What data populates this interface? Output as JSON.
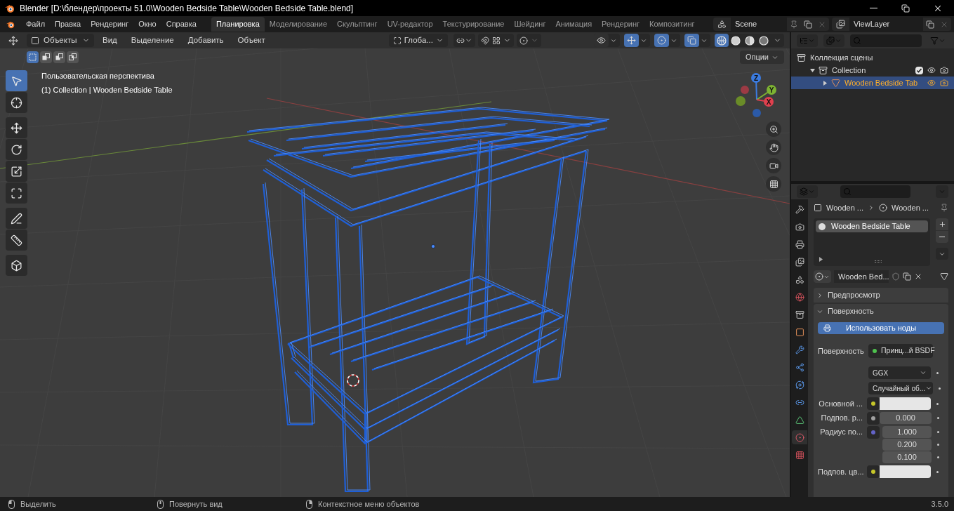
{
  "window": {
    "title": "Blender [D:\\блендер\\проекты 51.0\\Wooden Bedside Table\\Wooden Bedside Table.blend]"
  },
  "menus": [
    "Файл",
    "Правка",
    "Рендеринг",
    "Окно",
    "Справка"
  ],
  "workspaces": [
    {
      "label": "Планировка",
      "selected": true
    },
    {
      "label": "Моделирование",
      "selected": false
    },
    {
      "label": "Скульптинг",
      "selected": false
    },
    {
      "label": "UV-редактор",
      "selected": false
    },
    {
      "label": "Текстурирование",
      "selected": false
    },
    {
      "label": "Шейдинг",
      "selected": false
    },
    {
      "label": "Анимация",
      "selected": false
    },
    {
      "label": "Рендеринг",
      "selected": false
    },
    {
      "label": "Композитинг",
      "selected": false
    }
  ],
  "scene": "Scene",
  "view_layer": "ViewLayer",
  "viewport": {
    "mode": "Объекты",
    "menus": [
      "Вид",
      "Выделение",
      "Добавить",
      "Объект"
    ],
    "orientation": "Глоба...",
    "toggles": [
      {
        "kind": "visibility",
        "on": false
      },
      {
        "kind": "gizmo",
        "on": true
      },
      {
        "kind": "overlay",
        "on": true
      },
      {
        "kind": "xray",
        "on": true
      }
    ],
    "shading_modes": [
      {
        "kind": "wireframe",
        "selected": true
      },
      {
        "kind": "solid",
        "selected": false
      },
      {
        "kind": "material",
        "selected": false
      },
      {
        "kind": "rendered",
        "selected": false
      }
    ],
    "select_modes": [
      {
        "kind": "new",
        "selected": true
      },
      {
        "kind": "extend",
        "selected": false
      },
      {
        "kind": "subtract",
        "selected": false
      },
      {
        "kind": "intersect",
        "selected": false
      }
    ],
    "options_button": "Опции",
    "overlay_lines": [
      "Пользовательская перспектива",
      "(1) Collection | Wooden Bedside Table"
    ],
    "tool_groups": [
      [
        {
          "kind": "select",
          "selected": true
        },
        {
          "kind": "cursor",
          "selected": false
        }
      ],
      [
        {
          "kind": "move",
          "selected": false
        },
        {
          "kind": "rotate",
          "selected": false
        },
        {
          "kind": "scale",
          "selected": false
        },
        {
          "kind": "transform",
          "selected": false
        }
      ],
      [
        {
          "kind": "annotate",
          "selected": false
        },
        {
          "kind": "measure",
          "selected": false
        }
      ],
      [
        {
          "kind": "add_cube",
          "selected": false
        }
      ]
    ],
    "axes": [
      "Z",
      "Y",
      "X"
    ]
  },
  "outliner": {
    "items": [
      {
        "label": "Коллекция сцены",
        "children": [
          {
            "label": "Collection",
            "expanded": true,
            "checked": true,
            "children": [
              {
                "label": "Wooden Bedside Tab",
                "expanded": false,
                "selected": true
              }
            ]
          }
        ]
      }
    ]
  },
  "properties": {
    "breadcrumb": [
      "Wooden ...",
      "Wooden ..."
    ],
    "tabs": [
      {
        "kind": "tool",
        "selected": false
      },
      {
        "kind": "render",
        "selected": false
      },
      {
        "kind": "output",
        "selected": false
      },
      {
        "kind": "view_layer",
        "selected": false
      },
      {
        "kind": "scene",
        "selected": false
      },
      {
        "kind": "world",
        "selected": false
      },
      {
        "kind": "collection",
        "selected": false
      },
      {
        "kind": "object",
        "selected": false
      },
      {
        "kind": "modifier",
        "selected": false
      },
      {
        "kind": "particles",
        "selected": false
      },
      {
        "kind": "physics",
        "selected": false
      },
      {
        "kind": "constraints",
        "selected": false
      },
      {
        "kind": "data",
        "selected": false
      },
      {
        "kind": "material",
        "selected": true
      },
      {
        "kind": "texture",
        "selected": false
      }
    ],
    "material_slots": [
      {
        "label": "Wooden Bedside Table",
        "selected": true
      }
    ],
    "material_name": "Wooden Bed...",
    "panels": [
      {
        "label": "Предпросмотр",
        "expanded": false
      },
      {
        "label": "Поверхность",
        "expanded": true
      }
    ],
    "use_nodes_button": "Использовать ноды",
    "rows": [
      {
        "kind": "link",
        "label": "Поверхность",
        "value": "Принц...й BSDF",
        "color": "#4ec24e"
      },
      {
        "kind": "dropdown",
        "value": "GGX"
      },
      {
        "kind": "dropdown",
        "value": "Случайный об..."
      },
      {
        "kind": "color",
        "label": "Основной ...",
        "color": "#c7c729"
      },
      {
        "kind": "number",
        "label": "Подпов. р...",
        "values": [
          "0.000"
        ],
        "color": "#a1a1a1"
      },
      {
        "kind": "number",
        "label": "Радиус по...",
        "values": [
          "1.000",
          "0.200",
          "0.100"
        ],
        "color": "#6363c7"
      },
      {
        "kind": "color",
        "label": "Подпов. цв...",
        "color": "#c7c729"
      }
    ]
  },
  "status_bar": {
    "hints": [
      {
        "kind": "left",
        "label": "Выделить"
      },
      {
        "kind": "middle",
        "label": "Повернуть вид"
      },
      {
        "kind": "right",
        "label": "Контекстное меню объектов"
      }
    ],
    "version": "3.5.0"
  }
}
